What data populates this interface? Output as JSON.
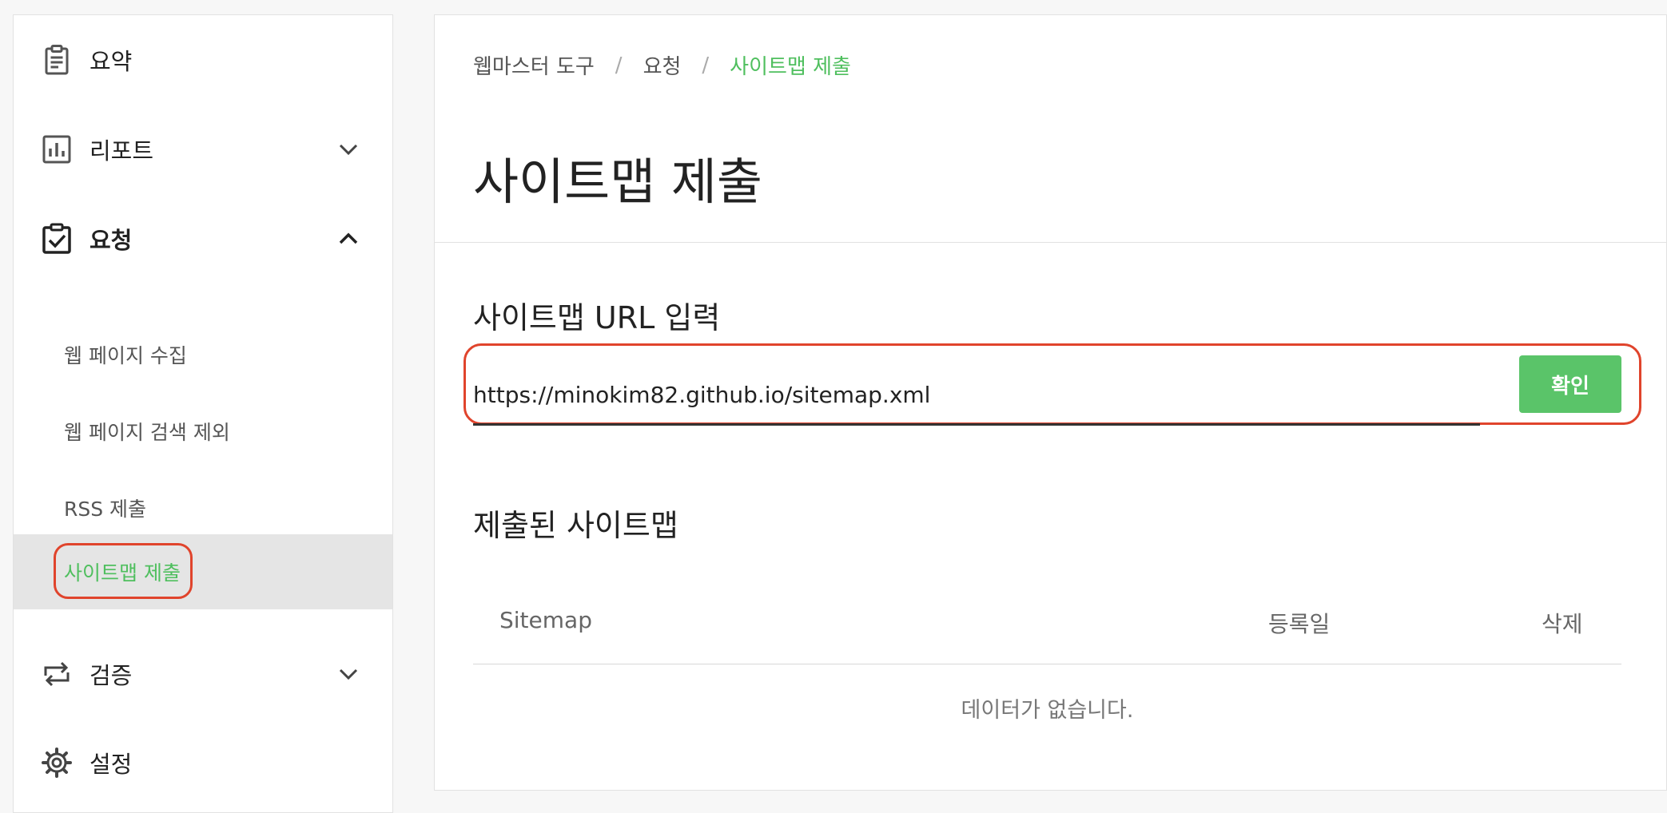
{
  "sidebar": {
    "summary_label": "요약",
    "report_label": "리포트",
    "request_label": "요청",
    "request_items": [
      {
        "label": "웹 페이지 수집"
      },
      {
        "label": "웹 페이지 검색 제외"
      },
      {
        "label": "RSS 제출"
      },
      {
        "label": "사이트맵 제출"
      }
    ],
    "verify_label": "검증",
    "settings_label": "설정"
  },
  "breadcrumb": {
    "root": "웹마스터 도구",
    "middle": "요청",
    "current": "사이트맵 제출",
    "separator": "/"
  },
  "page": {
    "title": "사이트맵 제출",
    "url_section_label": "사이트맵 URL 입력",
    "url_value": "https://minokim82.github.io/sitemap.xml",
    "confirm_label": "확인",
    "submitted_label": "제출된 사이트맵",
    "table": {
      "columns": [
        "Sitemap",
        "등록일",
        "삭제"
      ],
      "empty_message": "데이터가 없습니다."
    }
  },
  "colors": {
    "accent_green": "#4fbf5e",
    "button_green": "#5ac469",
    "highlight_red": "#e0442c"
  },
  "icons": {
    "summary": "clipboard-list-icon",
    "report": "bar-chart-icon",
    "request": "clipboard-check-icon",
    "verify": "repeat-arrows-icon",
    "settings": "gear-icon"
  }
}
